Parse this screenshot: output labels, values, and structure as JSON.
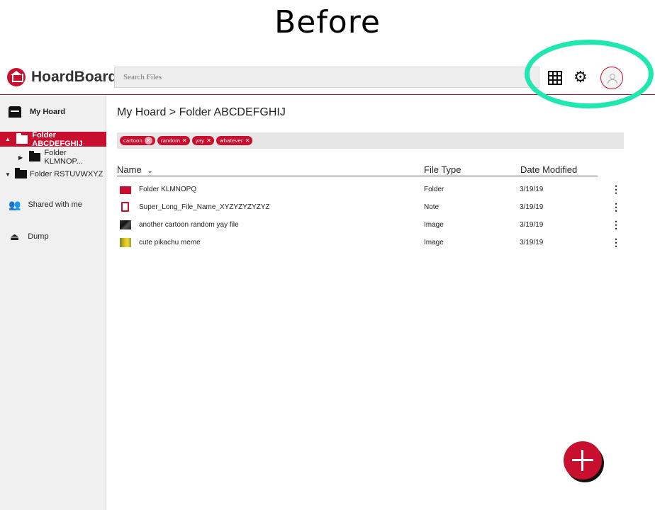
{
  "caption": "Before",
  "app": {
    "name": "HoardBoard",
    "brand_color": "#c8102e",
    "highlight_color": "#1ee8b0"
  },
  "search": {
    "placeholder": "Search Files"
  },
  "sidebar": {
    "items": [
      {
        "label": "My Hoard",
        "icon": "drawer-icon"
      },
      {
        "label": "Folder ABCDEFGHIJ",
        "icon": "folder-icon",
        "active": true,
        "expanded": true
      },
      {
        "label": "Folder KLMNOP...",
        "icon": "folder-icon"
      },
      {
        "label": "Folder RSTUVWXYZ",
        "icon": "folder-icon",
        "expanded": true
      },
      {
        "label": "Shared with me",
        "icon": "people-icon"
      },
      {
        "label": "Dump",
        "icon": "upload-icon"
      }
    ]
  },
  "breadcrumb": "My Hoard > Folder ABCDEFGHIJ",
  "tags": [
    {
      "label": "cartoon"
    },
    {
      "label": "random"
    },
    {
      "label": "yay"
    },
    {
      "label": "whatever"
    }
  ],
  "table": {
    "columns": [
      "Name",
      "File Type",
      "Date Modified"
    ],
    "sort_icon": "chevron-down-icon",
    "rows": [
      {
        "name": "Folder KLMNOPQ",
        "type": "Folder",
        "date": "3/19/19",
        "icon": "folder-icon"
      },
      {
        "name": "Super_Long_File_Name_XYZYZYZYZYZ",
        "type": "Note",
        "date": "3/19/19",
        "icon": "note-icon"
      },
      {
        "name": "another cartoon random yay file",
        "type": "Image",
        "date": "3/19/19",
        "icon": "image-thumb-icon"
      },
      {
        "name": "cute pikachu meme",
        "type": "Image",
        "date": "3/19/19",
        "icon": "image-thumb-icon"
      }
    ],
    "menu_glyph": "⋮"
  },
  "fab": {
    "icon": "plus-icon"
  }
}
